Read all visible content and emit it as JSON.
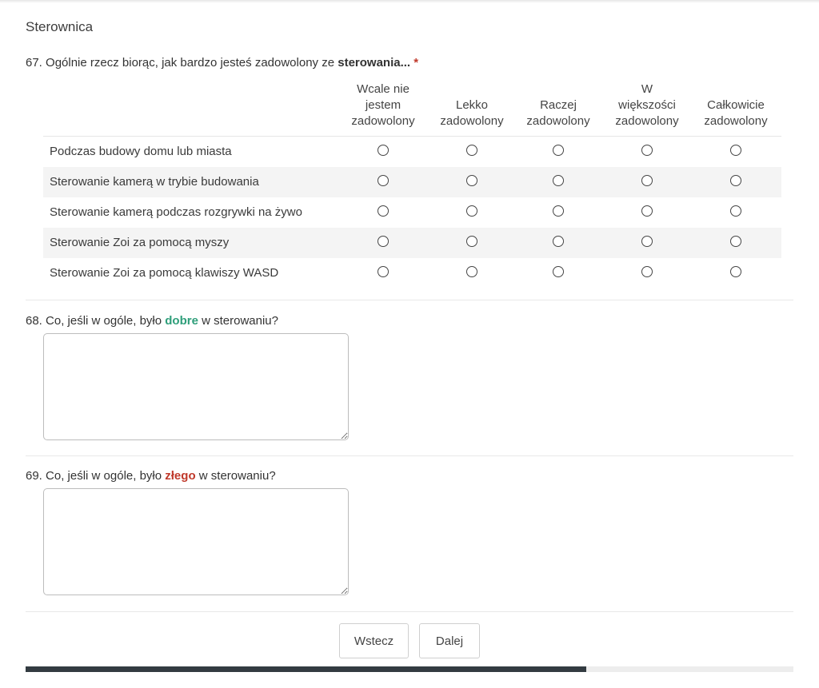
{
  "section_title": "Sterownica",
  "q67": {
    "number": "67.",
    "text": "Ogólnie rzecz biorąc, jak bardzo jesteś zadowolony ze",
    "bold": "sterowania...",
    "required_mark": "*",
    "columns": [
      [
        "Wcale nie",
        "jestem",
        "zadowolony"
      ],
      [
        "Lekko",
        "zadowolony"
      ],
      [
        "Raczej",
        "zadowolony"
      ],
      [
        "W",
        "większości",
        "zadowolony"
      ],
      [
        "Całkowicie",
        "zadowolony"
      ]
    ],
    "rows": [
      "Podczas budowy domu lub miasta",
      "Sterowanie kamerą w trybie budowania",
      "Sterowanie kamerą podczas rozgrywki na żywo",
      "Sterowanie Zoi za pomocą myszy",
      "Sterowanie Zoi za pomocą klawiszy WASD"
    ]
  },
  "q68": {
    "prefix": "68. Co, jeśli w ogóle, było",
    "highlight": "dobre",
    "suffix": "w sterowaniu?",
    "highlight_color": "#2e9e7a"
  },
  "q69": {
    "prefix": "69. Co, jeśli w ogóle, było",
    "highlight": "złego",
    "suffix": "w sterowaniu?",
    "highlight_color": "#c0392b"
  },
  "buttons": {
    "back": "Wstecz",
    "next": "Dalej"
  },
  "progress": {
    "fraction": 0.73
  }
}
